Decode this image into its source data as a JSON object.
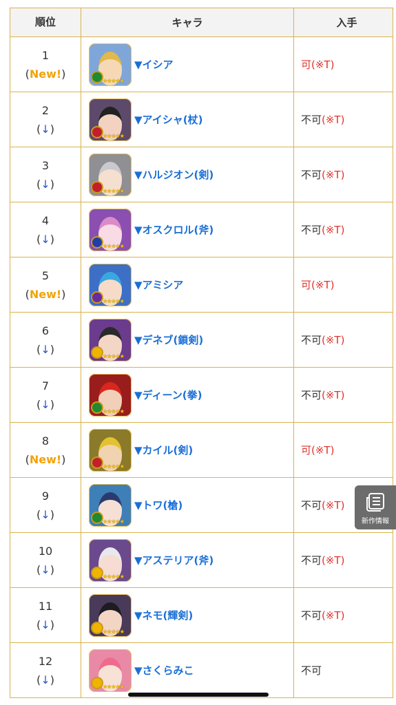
{
  "table": {
    "headers": {
      "rank": "順位",
      "chara": "キャラ",
      "get": "入手"
    },
    "rows": [
      {
        "rank": "1",
        "open": "(",
        "change": "New!",
        "close": ")",
        "change_type": "new",
        "name": "▼イシア",
        "get_main": "可",
        "get_note": "(※T)",
        "get_ok": true,
        "avatar": {
          "bg": "#7fa6d8",
          "face": "#f6d9b4",
          "hair": "#e2b94a",
          "orb": "#1f8a2f"
        }
      },
      {
        "rank": "2",
        "open": "(",
        "change": "↓",
        "close": ")",
        "change_type": "down",
        "name": "▼アイシャ(杖)",
        "get_main": "不可",
        "get_note": "(※T)",
        "get_ok": false,
        "avatar": {
          "bg": "#5d4a6a",
          "face": "#f3d2c2",
          "hair": "#222222",
          "orb": "#c21f2a"
        }
      },
      {
        "rank": "3",
        "open": "(",
        "change": "↓",
        "close": ")",
        "change_type": "down",
        "name": "▼ハルジオン(剣)",
        "get_main": "不可",
        "get_note": "(※T)",
        "get_ok": false,
        "avatar": {
          "bg": "#8f8f94",
          "face": "#f5e0cf",
          "hair": "#c9c9cf",
          "orb": "#c21f2a"
        }
      },
      {
        "rank": "4",
        "open": "(",
        "change": "↓",
        "close": ")",
        "change_type": "down",
        "name": "▼オスクロル(斧)",
        "get_main": "不可",
        "get_note": "(※T)",
        "get_ok": false,
        "avatar": {
          "bg": "#8a4fb0",
          "face": "#f8dbe4",
          "hair": "#d98cc8",
          "orb": "#1f3fa8"
        }
      },
      {
        "rank": "5",
        "open": "(",
        "change": "New!",
        "close": ")",
        "change_type": "new",
        "name": "▼アミシア",
        "get_main": "可",
        "get_note": "(※T)",
        "get_ok": true,
        "avatar": {
          "bg": "#3d6fc6",
          "face": "#f6dcc8",
          "hair": "#3aa7e0",
          "orb": "#6a2aa0"
        }
      },
      {
        "rank": "6",
        "open": "(",
        "change": "↓",
        "close": ")",
        "change_type": "down",
        "name": "▼デネブ(鎖剣)",
        "get_main": "不可",
        "get_note": "(※T)",
        "get_ok": false,
        "avatar": {
          "bg": "#6b3b8e",
          "face": "#f4d6c6",
          "hair": "#2a2a2a",
          "orb": "#f0b400"
        }
      },
      {
        "rank": "7",
        "open": "(",
        "change": "↓",
        "close": ")",
        "change_type": "down",
        "name": "▼ディーン(拳)",
        "get_main": "不可",
        "get_note": "(※T)",
        "get_ok": false,
        "avatar": {
          "bg": "#9a1d1d",
          "face": "#f2cfb8",
          "hair": "#d8281e",
          "orb": "#1f8a2f"
        }
      },
      {
        "rank": "8",
        "open": "(",
        "change": "New!",
        "close": ")",
        "change_type": "new",
        "name": "▼カイル(剣)",
        "get_main": "可",
        "get_note": "(※T)",
        "get_ok": true,
        "avatar": {
          "bg": "#8a7a2a",
          "face": "#f1d3b0",
          "hair": "#e2c230",
          "orb": "#c21f2a"
        }
      },
      {
        "rank": "9",
        "open": "(",
        "change": "↓",
        "close": ")",
        "change_type": "down",
        "name": "▼トワ(槍)",
        "get_main": "不可",
        "get_note": "(※T)",
        "get_ok": false,
        "avatar": {
          "bg": "#3e7fb8",
          "face": "#f6e0d6",
          "hair": "#2b3b6e",
          "orb": "#1f8a2f"
        }
      },
      {
        "rank": "10",
        "open": "(",
        "change": "↓",
        "close": ")",
        "change_type": "down",
        "name": "▼アステリア(斧)",
        "get_main": "不可",
        "get_note": "(※T)",
        "get_ok": false,
        "avatar": {
          "bg": "#6a4a8c",
          "face": "#f6dcd2",
          "hair": "#e8e8ee",
          "orb": "#f0b400"
        }
      },
      {
        "rank": "11",
        "open": "(",
        "change": "↓",
        "close": ")",
        "change_type": "down",
        "name": "▼ネモ(輝剣)",
        "get_main": "不可",
        "get_note": "(※T)",
        "get_ok": false,
        "avatar": {
          "bg": "#4a3a5a",
          "face": "#f3d5c6",
          "hair": "#1c1c22",
          "orb": "#f0b400"
        }
      },
      {
        "rank": "12",
        "open": "(",
        "change": "↓",
        "close": ")",
        "change_type": "down",
        "name": "▼さくらみこ",
        "get_main": "不可",
        "get_note": "",
        "get_ok": false,
        "avatar": {
          "bg": "#e88aa6",
          "face": "#f8e2d6",
          "hair": "#ef6b8e",
          "orb": "#f0b400"
        }
      }
    ],
    "stars": "★★★★★"
  },
  "float_button": {
    "label": "新作情報",
    "icon": "news-list-icon"
  },
  "colors": {
    "border": "#d9b24a",
    "link": "#1a6fd6",
    "new": "#f0a30a",
    "down_arrow": "#2b57c8",
    "available": "#e0312b"
  }
}
